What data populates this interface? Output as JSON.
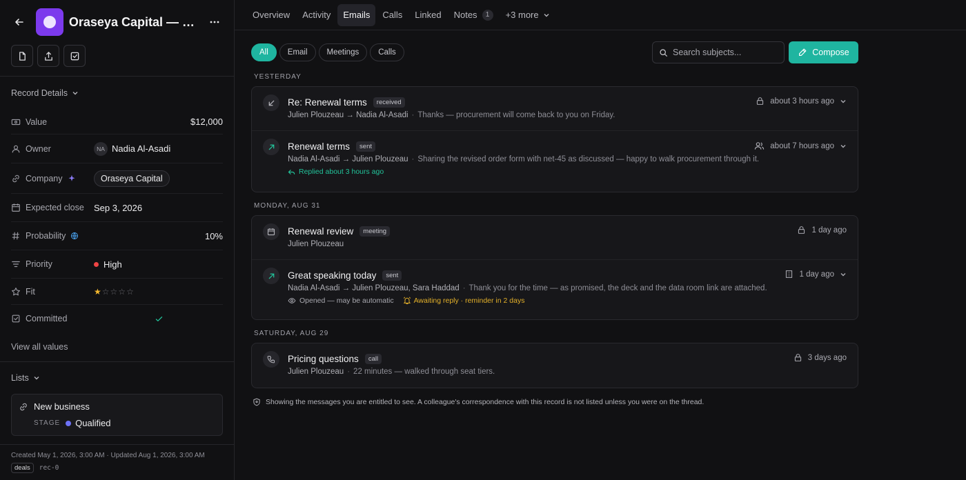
{
  "record": {
    "title": "Oraseya Capital — S...",
    "logo_color": "#7c3aed"
  },
  "details": {
    "header": "Record Details",
    "value_label": "Value",
    "value": "$12,000",
    "owner_label": "Owner",
    "owner_initials": "NA",
    "owner_name": "Nadia Al-Asadi",
    "company_label": "Company",
    "company": "Oraseya Capital",
    "expected_close_label": "Expected close",
    "expected_close": "Sep 3, 2026",
    "probability_label": "Probability",
    "probability": "10%",
    "priority_label": "Priority",
    "priority": "High",
    "fit_label": "Fit",
    "fit_rating": 1,
    "fit_max": 5,
    "committed_label": "Committed",
    "committed": true,
    "view_all": "View all values"
  },
  "lists": {
    "header": "Lists",
    "item_name": "New business",
    "stage_label": "STAGE",
    "stage_value": "Qualified"
  },
  "meta": {
    "created_updated": "Created May 1, 2026, 3:00 AM · Updated Aug 1, 2026, 3:00 AM",
    "tag": "deals",
    "record_id": "rec-0"
  },
  "tabs": {
    "overview": "Overview",
    "activity": "Activity",
    "emails": "Emails",
    "calls": "Calls",
    "linked": "Linked",
    "notes": "Notes",
    "notes_count": "1",
    "more": "+3 more"
  },
  "filters": {
    "all": "All",
    "email": "Email",
    "meetings": "Meetings",
    "calls": "Calls"
  },
  "search": {
    "placeholder": "Search subjects..."
  },
  "compose_label": "Compose",
  "groups": [
    {
      "header": "YESTERDAY",
      "items": [
        {
          "subject": "Re: Renewal terms",
          "badge": "received",
          "participants": "Julien Plouzeau → Nadia Al-Asadi",
          "snippet": "Thanks — procurement will come back to you on Friday.",
          "time": "about 3 hours ago"
        },
        {
          "subject": "Renewal terms",
          "badge": "sent",
          "participants": "Nadia Al-Asadi → Julien Plouzeau",
          "snippet": "Sharing the revised order form with net-45 as discussed — happy to walk procurement through it.",
          "time": "about 7 hours ago",
          "replied": "Replied about 3 hours ago"
        }
      ]
    },
    {
      "header": "MONDAY, AUG 31",
      "items": [
        {
          "subject": "Renewal review",
          "badge": "meeting",
          "participants": "Julien Plouzeau",
          "time": "1 day ago"
        },
        {
          "subject": "Great speaking today",
          "badge": "sent",
          "participants": "Nadia Al-Asadi → Julien Plouzeau, Sara Haddad",
          "snippet": "Thank you for the time — as promised, the deck and the data room link are attached.",
          "time": "1 day ago",
          "opened": "Opened — may be automatic",
          "awaiting": "Awaiting reply · reminder in 2 days"
        }
      ]
    },
    {
      "header": "SATURDAY, AUG 29",
      "items": [
        {
          "subject": "Pricing questions",
          "badge": "call",
          "participants": "Julien Plouzeau",
          "snippet": "22 minutes — walked through seat tiers.",
          "time": "3 days ago"
        }
      ]
    }
  ],
  "notice": "Showing the messages you are entitled to see. A colleague's correspondence with this record is not listed unless you were on the thread.",
  "colors": {
    "accent": "#1fb5a0",
    "danger": "#ef4444",
    "stage": "#6d72f6",
    "warning": "#e3b02a"
  }
}
